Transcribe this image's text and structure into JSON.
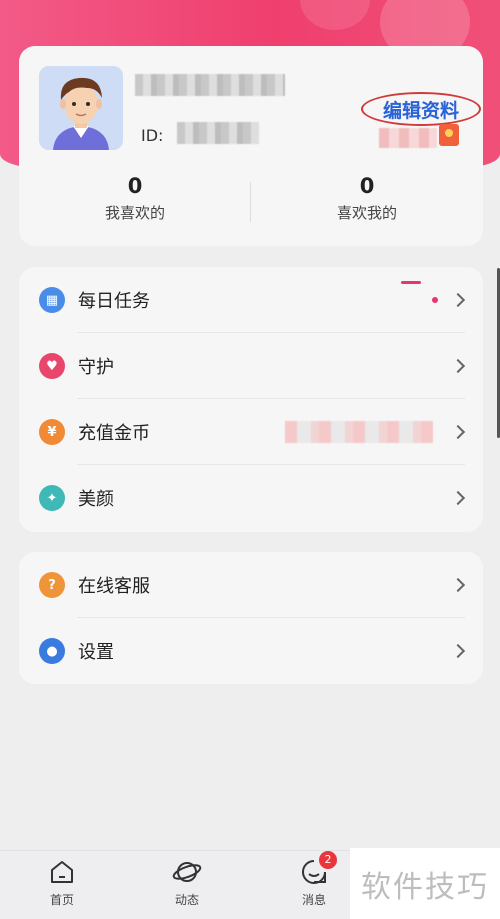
{
  "profile": {
    "id_label": "ID:",
    "edit_label": "编辑资料",
    "stats": [
      {
        "value": "0",
        "label": "我喜欢的"
      },
      {
        "value": "0",
        "label": "喜欢我的"
      }
    ]
  },
  "menu_group_1": [
    {
      "label": "每日任务",
      "icon": "calendar-icon",
      "color": "#4a8de8"
    },
    {
      "label": "守护",
      "icon": "shield-heart-icon",
      "color": "#e8466b"
    },
    {
      "label": "充值金币",
      "icon": "coin-icon",
      "color": "#f08a35"
    },
    {
      "label": "美颜",
      "icon": "beauty-wand-icon",
      "color": "#3eb9b7"
    }
  ],
  "menu_group_2": [
    {
      "label": "在线客服",
      "icon": "headset-icon",
      "color": "#f0943a"
    },
    {
      "label": "设置",
      "icon": "gear-icon",
      "color": "#3a7be0"
    }
  ],
  "tabbar": {
    "home": "首页",
    "dynamic": "动态",
    "messages": "消息",
    "messages_badge": "2"
  },
  "watermark": "软件技巧",
  "colors": {
    "brand_pink": "#ef3f6e",
    "accent_blue": "#2a63d6",
    "highlight_red": "#d23a3a"
  }
}
